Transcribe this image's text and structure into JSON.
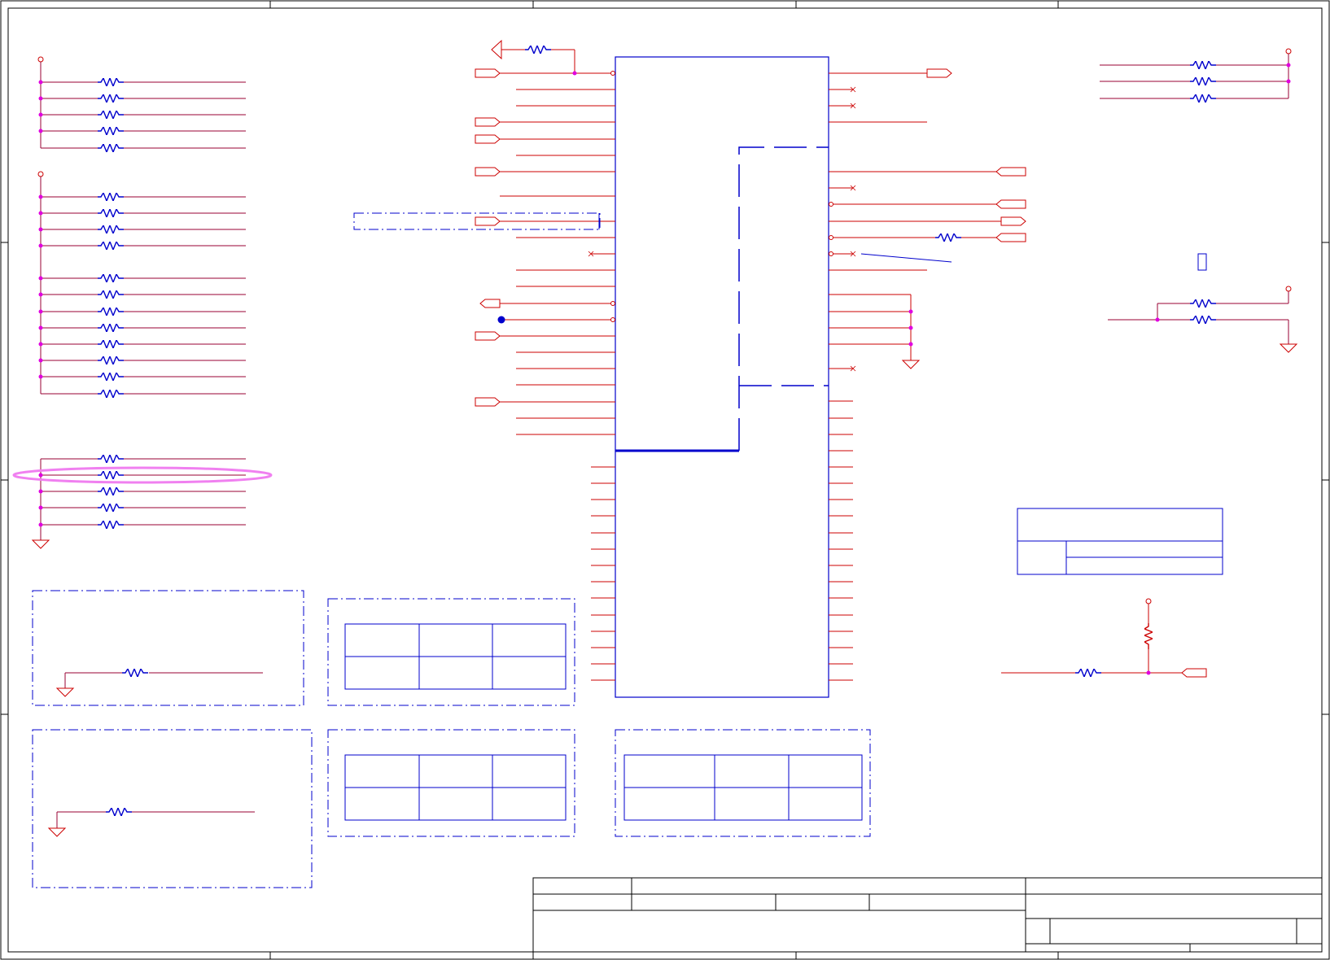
{
  "colors": {
    "frame": "#000000",
    "wire": "#cc0000",
    "net": "#990033",
    "component": "#0000cc",
    "junction": "#e000e0",
    "highlight": "#f080f0",
    "background": "#ffffff"
  },
  "elements": {
    "resistor_banks": [
      "bank-1",
      "bank-2",
      "bank-3",
      "bank-4"
    ],
    "main_ic": "ic-body",
    "tables": [
      "table-a",
      "table-b",
      "table-c",
      "legend-table",
      "title-block"
    ],
    "icons": [
      "power-flag-icon",
      "ground-icon",
      "port-icon",
      "junction-dot-icon",
      "resistor-icon",
      "no-connect-icon"
    ]
  }
}
